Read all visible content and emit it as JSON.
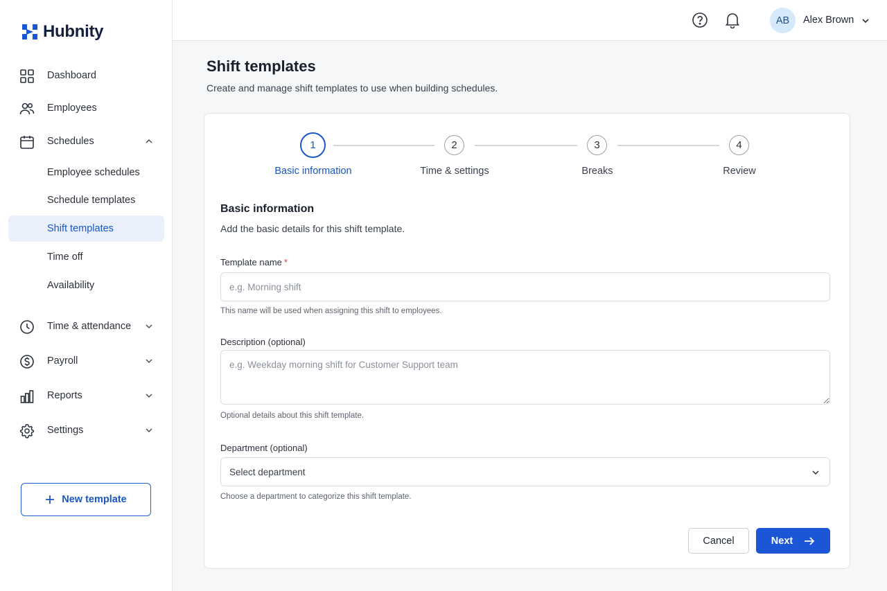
{
  "brand": {
    "name": "Hubnity",
    "accent": "#1a56c4"
  },
  "sidebar": {
    "items": [
      {
        "label": "Dashboard",
        "icon": "grid-icon"
      },
      {
        "label": "Employees",
        "icon": "users-icon"
      },
      {
        "label": "Schedules",
        "icon": "calendar-icon",
        "expanded": true
      },
      {
        "label": "Time & attendance",
        "icon": "clock-icon"
      },
      {
        "label": "Payroll",
        "icon": "dollar-icon"
      },
      {
        "label": "Reports",
        "icon": "bar-chart-icon"
      },
      {
        "label": "Settings",
        "icon": "gear-icon"
      }
    ],
    "schedules_sub": [
      {
        "label": "Employee schedules"
      },
      {
        "label": "Schedule templates"
      },
      {
        "label": "Shift templates",
        "active": true
      },
      {
        "label": "Time off"
      },
      {
        "label": "Availability"
      }
    ],
    "new_template_label": "New template"
  },
  "header": {
    "avatar_initials": "AB",
    "user_name": "Alex Brown"
  },
  "page": {
    "title": "Shift templates",
    "subtitle": "Create and manage shift templates to use when building schedules."
  },
  "stepper": {
    "current": 1,
    "steps": [
      {
        "number": "1",
        "label": "Basic information"
      },
      {
        "number": "2",
        "label": "Time & settings"
      },
      {
        "number": "3",
        "label": "Breaks"
      },
      {
        "number": "4",
        "label": "Review"
      }
    ]
  },
  "form": {
    "section_title": "Basic information",
    "section_desc": "Add the basic details for this shift template.",
    "template_name": {
      "label": "Template name",
      "required_mark": "*",
      "value": "",
      "placeholder": "e.g. Morning shift",
      "helper": "This name will be used when assigning this shift to employees."
    },
    "description": {
      "label": "Description (optional)",
      "value": "",
      "placeholder": "e.g. Weekday morning shift for Customer Support team",
      "helper": "Optional details about this shift template."
    },
    "department": {
      "label": "Department (optional)",
      "selected": "Select department",
      "helper": "Choose a department to categorize this shift template."
    },
    "cancel_label": "Cancel",
    "next_label": "Next"
  }
}
